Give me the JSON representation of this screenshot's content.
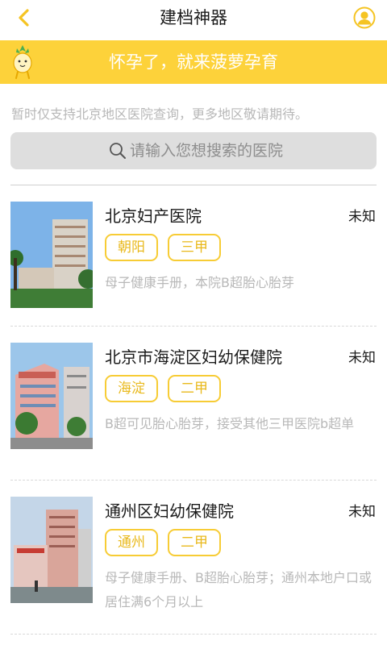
{
  "nav": {
    "title": "建档神器",
    "back_icon": "chevron-left-icon",
    "user_icon": "user-avatar-icon",
    "accent": "#f5c423"
  },
  "banner": {
    "slogan": "怀孕了，就来菠萝孕育",
    "color": "#fdd23a"
  },
  "notice": "暂时仅支持北京地区医院查询，更多地区敬请期待。",
  "search": {
    "placeholder": "请输入您想搜索的医院",
    "icon": "search-icon"
  },
  "hospitals": [
    {
      "name": "北京妇产医院",
      "status": "未知",
      "tags": [
        "朝阳",
        "三甲"
      ],
      "desc": "母子健康手册，本院B超胎心胎芽"
    },
    {
      "name": "北京市海淀区妇幼保健院",
      "status": "未知",
      "tags": [
        "海淀",
        "二甲"
      ],
      "desc": "B超可见胎心胎芽，接受其他三甲医院b超单"
    },
    {
      "name": "通州区妇幼保健院",
      "status": "未知",
      "tags": [
        "通州",
        "二甲"
      ],
      "desc": "母子健康手册、B超胎心胎芽；通州本地户口或居住满6个月以上"
    }
  ]
}
